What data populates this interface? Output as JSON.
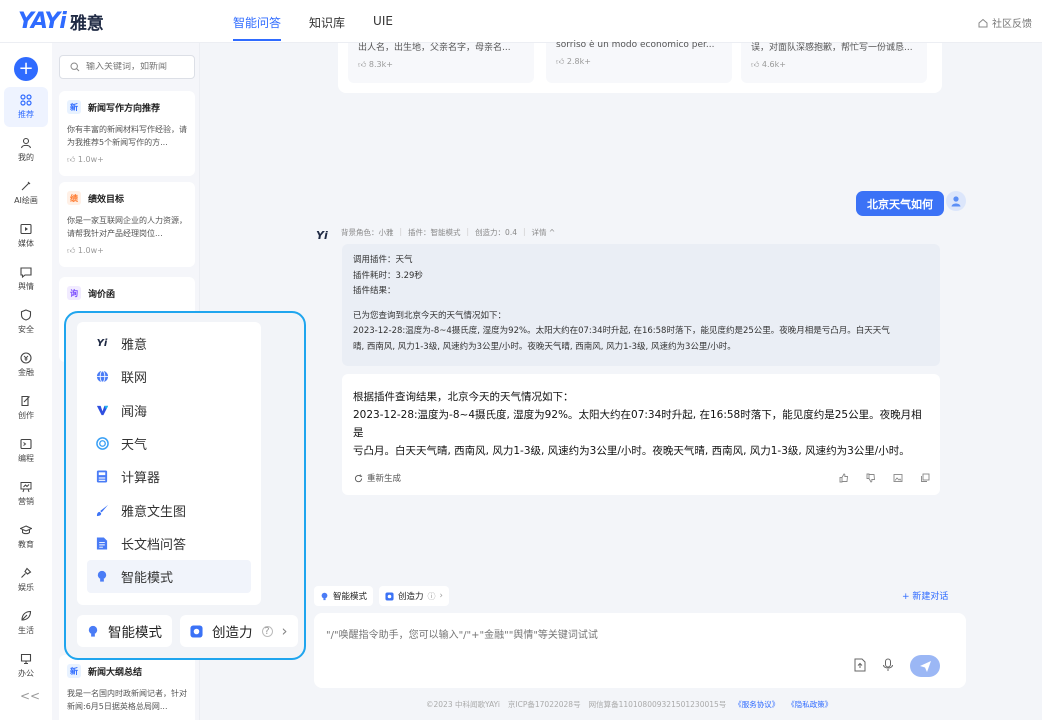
{
  "header": {
    "logo_en": "YAYi",
    "logo_cn": "雅意",
    "tabs": [
      "智能问答",
      "知识库",
      "UIE"
    ],
    "feedback": "社区反馈"
  },
  "rail": {
    "items": [
      "推荐",
      "我的",
      "AI绘画",
      "媒体",
      "舆情",
      "安全",
      "金融",
      "创作",
      "编程",
      "营销",
      "教育",
      "娱乐",
      "生活",
      "办公"
    ],
    "collapse": "<<"
  },
  "reclist": {
    "search_placeholder": "输入关键词，如新闻",
    "cards": [
      {
        "badge": "新",
        "title": "新闻写作方向推荐",
        "desc": "你有丰富的新闻材料写作经验，请为我推荐5个新闻写作的方...",
        "count": "1.0w+",
        "badge_color": "#e8f2ff",
        "badge_text_color": "#2f6bff"
      },
      {
        "badge": "绩",
        "title": "绩效目标",
        "desc": "你是一家互联网企业的人力资源， 请帮我针对产品经理岗位...",
        "count": "1.0w+",
        "badge_color": "#fff0e6",
        "badge_text_color": "#ff7a2e"
      },
      {
        "badge": "询",
        "title": "询价函",
        "desc": "",
        "count": "",
        "badge_color": "#f1ebff",
        "badge_text_color": "#7a4cff"
      },
      {
        "badge": "新",
        "title": "新闻大纲总结",
        "desc": "我是一名国内时政新闻记者，针对新闻:6月5日据英格总局网...",
        "count": "",
        "badge_color": "#e8f2ff",
        "badge_text_color": "#2f6bff"
      }
    ]
  },
  "top_cards": [
    {
      "text": "出人名，出生地，父亲名字，母亲名...",
      "count": "8.3k+"
    },
    {
      "text": "sorriso è un modo economico per...",
      "count": "2.8k+"
    },
    {
      "text": "误，对面队深感抱歉，帮忙写一份诚恳...",
      "count": "4.6k+"
    }
  ],
  "chat": {
    "user_message": "北京天气如何",
    "meta": [
      "背景角色：小雅",
      "|",
      "插件：智能模式",
      "|",
      "创造力：0.4",
      "|",
      "详情 ^"
    ],
    "plugin_lines": [
      "调用插件：天气",
      "插件耗时：3.29秒",
      "插件结果："
    ],
    "plugin_result_lines": [
      "已为您查询到北京今天的天气情况如下：",
      "2023-12-28:温度为-8~4摄氏度, 湿度为92%。太阳大约在07:34时升起, 在16:58时落下，能见度约是25公里。夜晚月相是亏凸月。白天天气",
      "晴, 西南风, 风力1-3级, 风速约为3公里/小时。夜晚天气晴, 西南风, 风力1-3级, 风速约为3公里/小时。"
    ],
    "answer_lines": [
      "根据插件查询结果，北京今天的天气情况如下：",
      "2023-12-28:温度为-8~4摄氏度, 湿度为92%。太阳大约在07:34时升起, 在16:58时落下，能见度约是25公里。夜晚月相是",
      "亏凸月。白天天气晴, 西南风, 风力1-3级, 风速约为3公里/小时。夜晚天气晴, 西南风, 风力1-3级, 风速约为3公里/小时。"
    ],
    "regenerate": "重新生成"
  },
  "composer": {
    "chip_mode": "智能模式",
    "chip_creativity": "创造力",
    "new_chat": "+ 新建对话",
    "placeholder": "\"/\"唤醒指令助手，您可以输入\"/\"+\"金融\"\"舆情\"等关键词试试"
  },
  "footer": {
    "copyright": "©2023 中科闻歌YAYi",
    "icp": "京ICP备17022028号",
    "police": "网信算备110108009321501230015号",
    "service": "《服务协议》",
    "privacy": "《隐私政策》"
  },
  "popup": {
    "items": [
      "雅意",
      "联网",
      "闻海",
      "天气",
      "计算器",
      "雅意文生图",
      "长文档问答",
      "智能模式"
    ],
    "selected": "智能模式",
    "chip_mode": "智能模式",
    "chip_creativity": "创造力"
  },
  "colors": {
    "accent": "#2f6bff",
    "popup_border": "#1fa5ee"
  }
}
